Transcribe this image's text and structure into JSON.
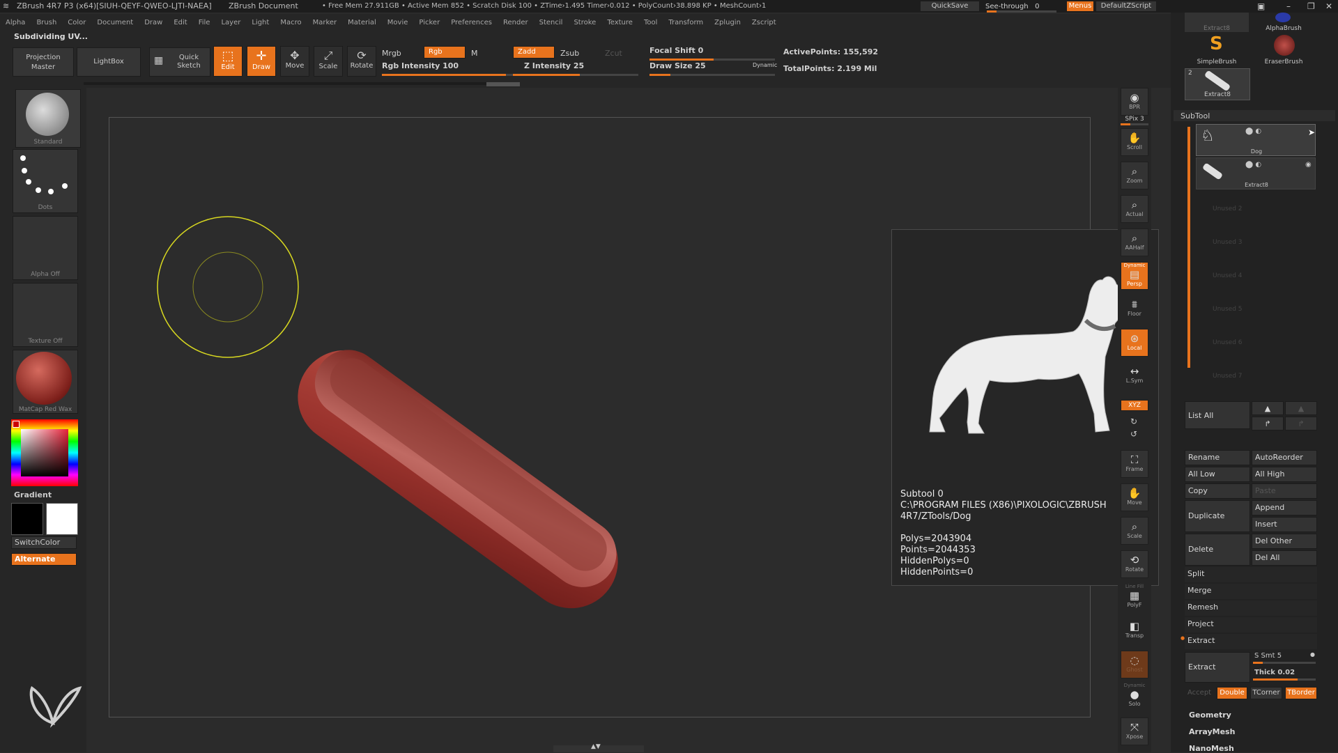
{
  "titlebar": {
    "app": "ZBrush 4R7 P3 (x64)[SIUH-QEYF-QWEO-LJTI-NAEA]",
    "doc": "ZBrush Document",
    "stats": "• Free Mem 27.911GB • Active Mem 852 • Scratch Disk 100 • ZTime›1.495 Timer›0.012 • PolyCount›38.898 KP • MeshCount›1",
    "quicksave": "QuickSave",
    "seethrough": "See-through",
    "seethrough_val": "0",
    "menus": "Menus",
    "script": "DefaultZScript"
  },
  "menubar": [
    "Alpha",
    "Brush",
    "Color",
    "Document",
    "Draw",
    "Edit",
    "File",
    "Layer",
    "Light",
    "Macro",
    "Marker",
    "Material",
    "Movie",
    "Picker",
    "Preferences",
    "Render",
    "Stencil",
    "Stroke",
    "Texture",
    "Tool",
    "Transform",
    "Zplugin",
    "Zscript"
  ],
  "status": "Subdividing UV...",
  "toolbar": {
    "projection_master": "Projection Master",
    "lightbox": "LightBox",
    "quick_sketch": "Quick Sketch",
    "edit": "Edit",
    "draw": "Draw",
    "move": "Move",
    "scale": "Scale",
    "rotate": "Rotate",
    "mrgb": "Mrgb",
    "rgb": "Rgb",
    "m": "M",
    "rgb_intensity": "Rgb Intensity 100",
    "zadd": "Zadd",
    "zsub": "Zsub",
    "zcut": "Zcut",
    "z_intensity": "Z Intensity 25",
    "focal_shift": "Focal Shift 0",
    "draw_size": "Draw Size 25",
    "dynamic": "Dynamic",
    "active_points": "ActivePoints: 155,592",
    "total_points": "TotalPoints: 2.199 Mil"
  },
  "left": {
    "brush": "Standard",
    "stroke": "Dots",
    "alpha": "Alpha Off",
    "texture": "Texture Off",
    "material": "MatCap Red Wax",
    "gradient": "Gradient",
    "switchcolor": "SwitchColor",
    "alternate": "Alternate"
  },
  "shelf": {
    "bpr": "BPR",
    "spix": "SPix 3",
    "scroll": "Scroll",
    "zoom": "Zoom",
    "actual": "Actual",
    "aahalf": "AAHalf",
    "dynamic": "Dynamic",
    "persp": "Persp",
    "floor": "Floor",
    "local": "Local",
    "lsym": "L.Sym",
    "xyz": "XYZ",
    "frame": "Frame",
    "move": "Move",
    "scale": "Scale",
    "rotate": "Rotate",
    "linefill": "Line Fill",
    "polyf": "PolyF",
    "transp": "Transp",
    "ghost": "Ghost",
    "solo_dynamic": "Dynamic",
    "solo": "Solo",
    "xpose": "Xpose"
  },
  "popup": {
    "subtool": "Subtool 0",
    "path1": "C:\\PROGRAM FILES (X86)\\PIXOLOGIC\\ZBRUSH",
    "path2": "4R7/ZTools/Dog",
    "polys": "Polys=2043904",
    "points": "Points=2044353",
    "hiddenpolys": "HiddenPolys=0",
    "hiddenpoints": "HiddenPoints=0"
  },
  "right": {
    "brushes": {
      "b1": "Extract8",
      "b2": "AlphaBrush",
      "b3": "SimpleBrush",
      "b4": "EraserBrush",
      "b5": "Extract8",
      "b5_num": "2"
    },
    "subtool_header": "SubTool",
    "items": [
      {
        "name": "Dog"
      },
      {
        "name": "Extract8"
      }
    ],
    "unused": [
      "Unused 2",
      "Unused 3",
      "Unused 4",
      "Unused 5",
      "Unused 6",
      "Unused 7"
    ],
    "list_all": "List  All",
    "rename": "Rename",
    "autoreorder": "AutoReorder",
    "all_low": "All Low",
    "all_high": "All High",
    "copy": "Copy",
    "paste": "Paste",
    "duplicate": "Duplicate",
    "append": "Append",
    "insert": "Insert",
    "delete": "Delete",
    "del_other": "Del Other",
    "del_all": "Del All",
    "split": "Split",
    "merge": "Merge",
    "remesh": "Remesh",
    "project": "Project",
    "extract_section": "Extract",
    "extract_btn": "Extract",
    "s_smt": "S Smt 5",
    "thick": "Thick 0.02",
    "accept": "Accept",
    "double": "Double",
    "tcorner": "TCorner",
    "tborder": "TBorder",
    "geometry": "Geometry",
    "arraymesh": "ArrayMesh",
    "nanomesh": "NanoMesh"
  },
  "colors": {
    "accent": "#e8731d",
    "band": "#a83a34"
  }
}
